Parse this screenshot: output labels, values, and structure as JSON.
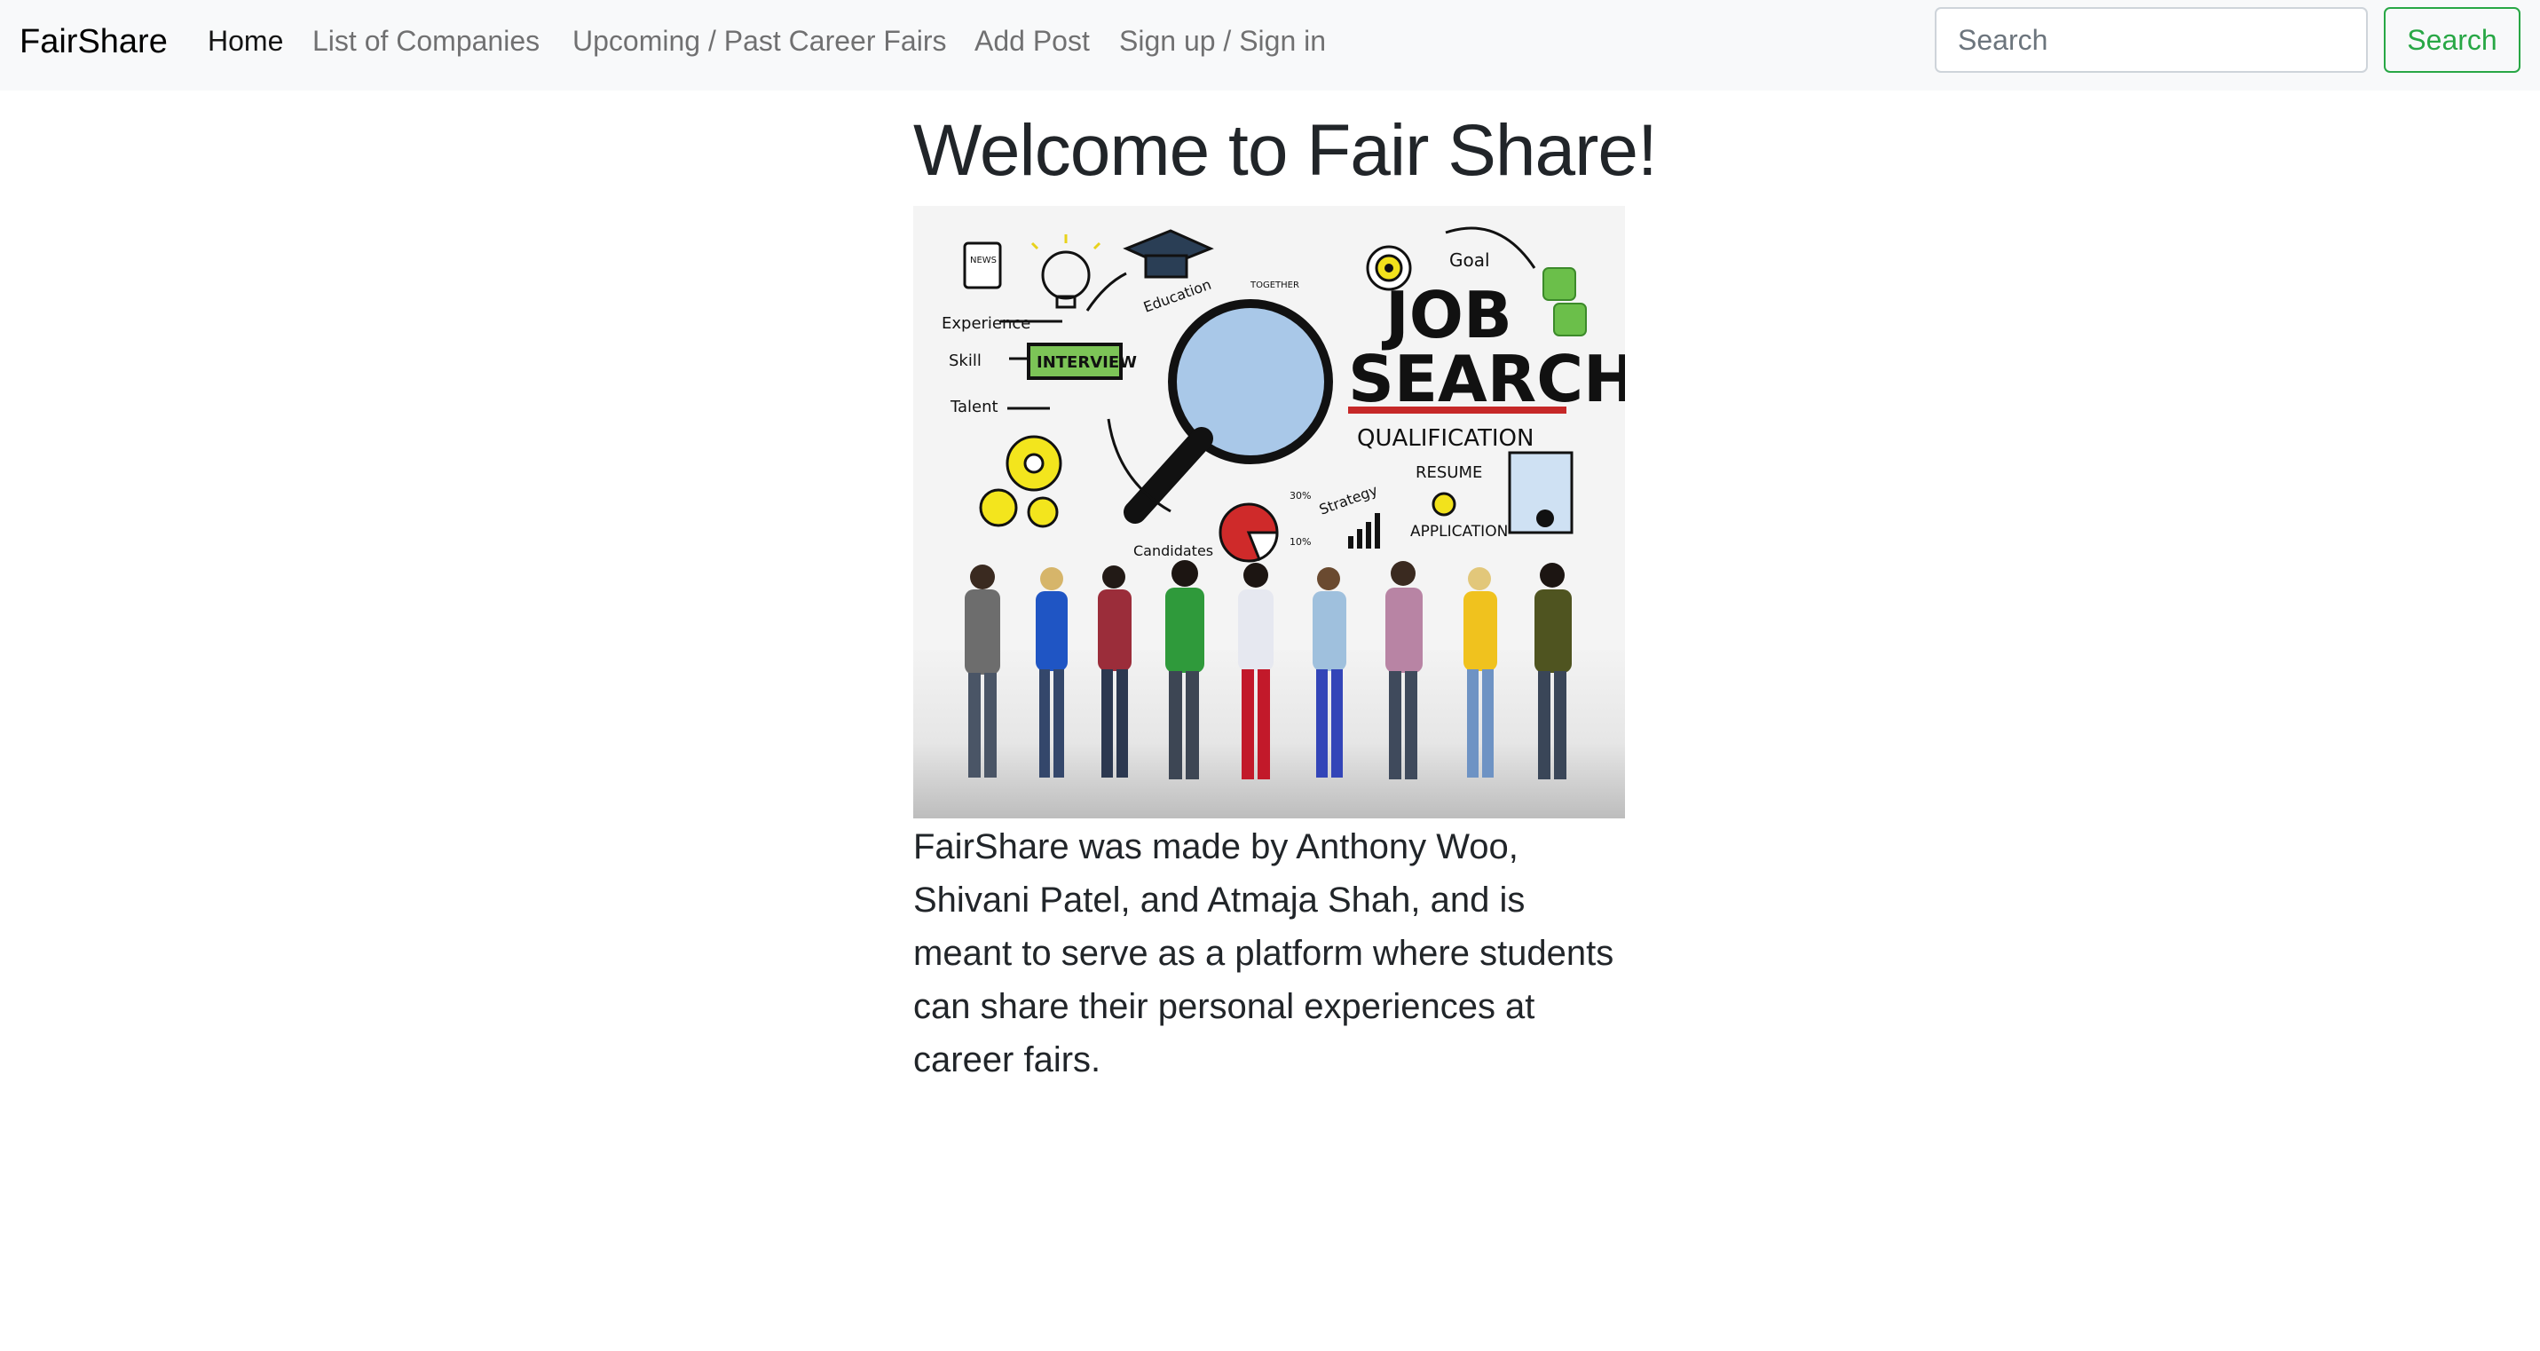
{
  "navbar": {
    "brand": "FairShare",
    "links": [
      {
        "label": "Home",
        "active": true
      },
      {
        "label": "List of Companies",
        "active": false
      },
      {
        "label": "Upcoming / Past Career Fairs",
        "active": false
      },
      {
        "label": "Add Post",
        "active": false
      },
      {
        "label": "Sign up / Sign in",
        "active": false
      }
    ],
    "search": {
      "placeholder": "Search",
      "value": "",
      "button_label": "Search"
    }
  },
  "main": {
    "title": "Welcome to Fair Share!",
    "hero_image": {
      "heading_line1": "JOB",
      "heading_line2": "SEARCH",
      "words": [
        "Goal",
        "Education",
        "TOGETHER",
        "NEWS",
        "Experience",
        "Skill",
        "INTERVIEW",
        "Talent",
        "QUALIFICATION",
        "RESUME",
        "APPLICATION",
        "Strategy",
        "Candidates",
        "30%",
        "10%"
      ]
    },
    "description": "FairShare was made by Anthony Woo, Shivani Patel, and Atmaja Shah, and is meant to serve as a platform where students can share their personal experiences at career fairs."
  },
  "colors": {
    "navbar_bg": "#f8f9fa",
    "success": "#28a745",
    "text": "#212529",
    "muted_link": "rgba(0,0,0,0.55)"
  }
}
